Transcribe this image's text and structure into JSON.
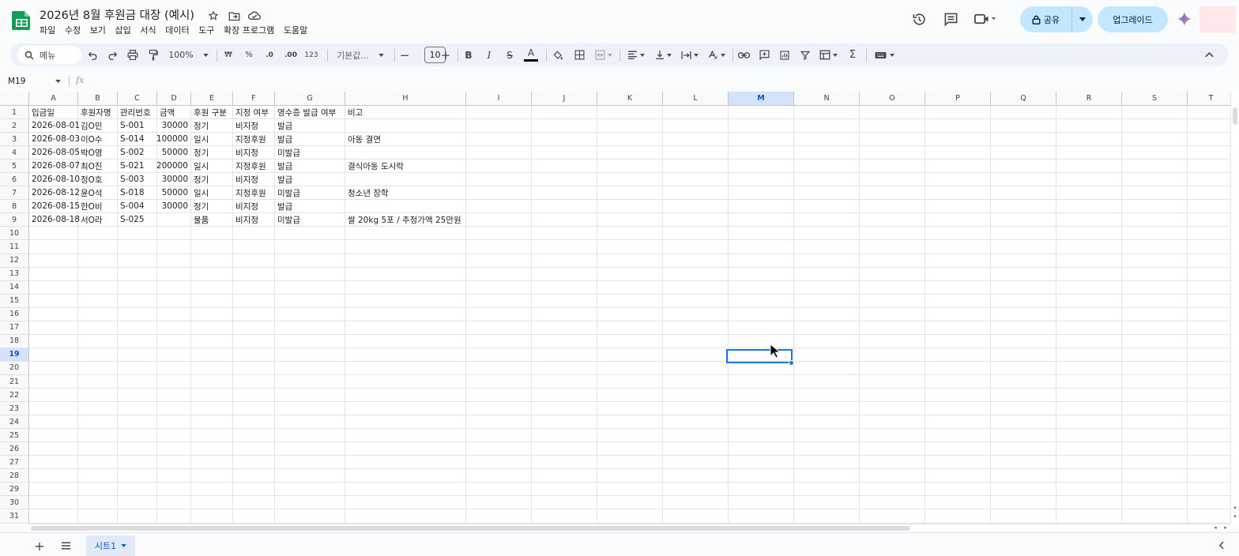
{
  "doc": {
    "title": "2026년 8월 후원금 대장 (예시)"
  },
  "menus": [
    "파일",
    "수정",
    "보기",
    "삽입",
    "서식",
    "데이터",
    "도구",
    "확장 프로그램",
    "도움말"
  ],
  "header_actions": {
    "share_label": "공유",
    "upgrade_label": "업그레이드"
  },
  "toolbar": {
    "search_label": "메뉴",
    "zoom": "100%",
    "currency": "₩",
    "percent": "%",
    "decimal_decrease": ".0",
    "decimal_increase": ".00",
    "number_format": "123",
    "font_name": "기본값...",
    "font_size": "10",
    "bold": "B",
    "italic": "I",
    "strike": "S",
    "text_color_letter": "A",
    "text_color": "#000000",
    "function": "Σ"
  },
  "formula_bar": {
    "name_box": "M19",
    "fx": "fx",
    "content": ""
  },
  "grid": {
    "columns": [
      "A",
      "B",
      "C",
      "D",
      "E",
      "F",
      "G",
      "H",
      "I",
      "J",
      "K",
      "L",
      "M",
      "N",
      "O",
      "P",
      "Q",
      "R",
      "S",
      "T"
    ],
    "selected_column": "M",
    "row_numbers": [
      "1",
      "2",
      "3",
      "4",
      "5",
      "6",
      "7",
      "8",
      "9",
      "10",
      "11",
      "12",
      "13",
      "14",
      "15",
      "16",
      "17",
      "18",
      "19",
      "20",
      "21",
      "22",
      "23",
      "24",
      "25",
      "26",
      "27",
      "28",
      "29",
      "30",
      "31"
    ],
    "selected_row": "19",
    "headers": [
      "입금일",
      "후원자명",
      "관리번호",
      "금액",
      "후원 구분",
      "지정 여부",
      "영수증 발급 여부",
      "비고"
    ],
    "rows": [
      [
        "2026-08-01",
        "김O민",
        "S-001",
        "30000",
        "정기",
        "비지정",
        "발급",
        ""
      ],
      [
        "2026-08-03",
        "이O수",
        "S-014",
        "100000",
        "일시",
        "지정후원",
        "발급",
        "아동 결연"
      ],
      [
        "2026-08-05",
        "박O영",
        "S-002",
        "50000",
        "정기",
        "비지정",
        "미발급",
        ""
      ],
      [
        "2026-08-07",
        "최O진",
        "S-021",
        "200000",
        "일시",
        "지정후원",
        "발급",
        "결식아동 도시락"
      ],
      [
        "2026-08-10",
        "정O호",
        "S-003",
        "30000",
        "정기",
        "비지정",
        "발급",
        ""
      ],
      [
        "2026-08-12",
        "윤O석",
        "S-018",
        "50000",
        "일시",
        "지정후원",
        "미발급",
        "청소년 장학"
      ],
      [
        "2026-08-15",
        "한O비",
        "S-004",
        "30000",
        "정기",
        "비지정",
        "발급",
        ""
      ],
      [
        "2026-08-18",
        "서O라",
        "S-025",
        "",
        "물품",
        "비지정",
        "미발급",
        "쌀 20kg 5포 / 추정가액 25만원"
      ]
    ]
  },
  "sheets": [
    {
      "name": "시트1",
      "active": true
    }
  ],
  "colors": {
    "accent": "#1a73e8",
    "share_bg": "#c2e7ff",
    "toolbar_bg": "#edf2fa",
    "selected_header_bg": "#d3e3fd"
  },
  "icons": [
    "sheets-logo-icon",
    "star-icon",
    "move-folder-icon",
    "cloud-status-icon",
    "history-icon",
    "comment-icon",
    "meet-icon",
    "lock-icon",
    "gemini-icon"
  ]
}
